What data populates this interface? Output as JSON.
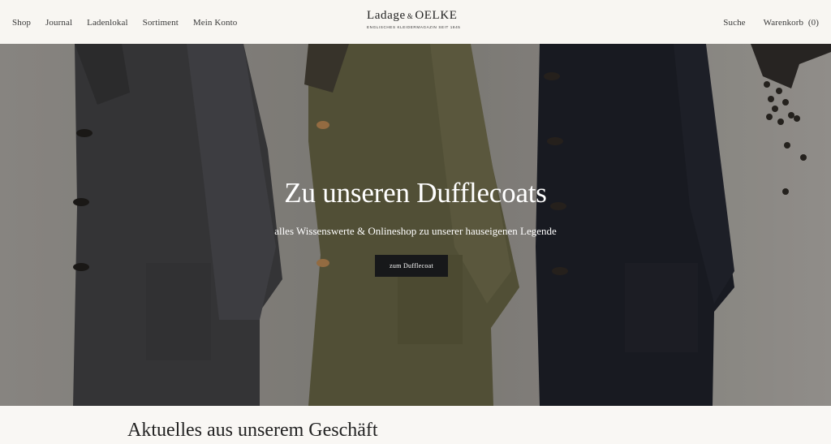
{
  "header": {
    "nav": [
      {
        "label": "Shop"
      },
      {
        "label": "Journal"
      },
      {
        "label": "Ladenlokal"
      },
      {
        "label": "Sortiment"
      },
      {
        "label": "Mein Konto"
      }
    ],
    "logo": {
      "name_left": "Ladage",
      "ampersand": "&",
      "name_right": "OELKE",
      "tagline": "ENGLISCHES KLEIDERMAGAZIN SEIT 1845"
    },
    "search_label": "Suche",
    "cart_label": "Warenkorb",
    "cart_count": "(0)"
  },
  "hero": {
    "title": "Zu unseren Dufflecoats",
    "subtitle": "alles Wissenswerte & Onlineshop zu unserer hauseigenen Legende",
    "button_label": "zum Dufflecoat",
    "colors": {
      "wall": "#8e8b86",
      "coat_left": "#3c3c3e",
      "coat_middle": "#5d5b3e",
      "coat_right": "#1c1e26"
    }
  },
  "news": {
    "heading": "Aktuelles aus unserem Geschäft"
  }
}
